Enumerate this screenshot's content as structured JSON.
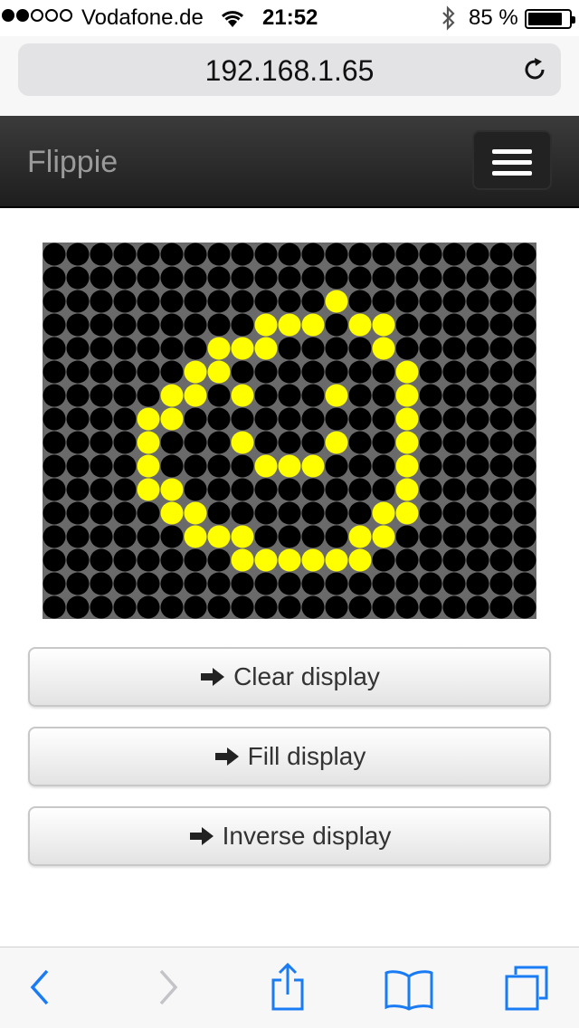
{
  "status_bar": {
    "carrier": "Vodafone.de",
    "time": "21:52",
    "battery_text": "85 %",
    "battery_level": 0.85,
    "signal_bars_filled": 2,
    "signal_bars_total": 5
  },
  "browser": {
    "url": "192.168.1.65"
  },
  "navbar": {
    "brand": "Flippie"
  },
  "display": {
    "columns": 21,
    "rows": 16,
    "on_color": "#ffff00",
    "off_color": "#000000",
    "lit_pixels": [
      [
        12,
        2
      ],
      [
        9,
        3
      ],
      [
        10,
        3
      ],
      [
        11,
        3
      ],
      [
        13,
        3
      ],
      [
        14,
        3
      ],
      [
        7,
        4
      ],
      [
        8,
        4
      ],
      [
        9,
        4
      ],
      [
        14,
        4
      ],
      [
        6,
        5
      ],
      [
        7,
        5
      ],
      [
        15,
        5
      ],
      [
        5,
        6
      ],
      [
        6,
        6
      ],
      [
        8,
        6
      ],
      [
        12,
        6
      ],
      [
        15,
        6
      ],
      [
        4,
        7
      ],
      [
        5,
        7
      ],
      [
        15,
        7
      ],
      [
        4,
        8
      ],
      [
        8,
        8
      ],
      [
        12,
        8
      ],
      [
        15,
        8
      ],
      [
        4,
        9
      ],
      [
        9,
        9
      ],
      [
        10,
        9
      ],
      [
        11,
        9
      ],
      [
        15,
        9
      ],
      [
        4,
        10
      ],
      [
        5,
        10
      ],
      [
        15,
        10
      ],
      [
        5,
        11
      ],
      [
        6,
        11
      ],
      [
        14,
        11
      ],
      [
        15,
        11
      ],
      [
        6,
        12
      ],
      [
        7,
        12
      ],
      [
        8,
        12
      ],
      [
        13,
        12
      ],
      [
        14,
        12
      ],
      [
        8,
        13
      ],
      [
        9,
        13
      ],
      [
        10,
        13
      ],
      [
        11,
        13
      ],
      [
        12,
        13
      ],
      [
        13,
        13
      ]
    ]
  },
  "buttons": {
    "clear": "Clear display",
    "fill": "Fill display",
    "inverse": "Inverse display"
  },
  "colors": {
    "navbar": "#2b2b2b",
    "toolbar_icon": "#1a7cf5",
    "toolbar_icon_disabled": "#c3c3c8"
  }
}
